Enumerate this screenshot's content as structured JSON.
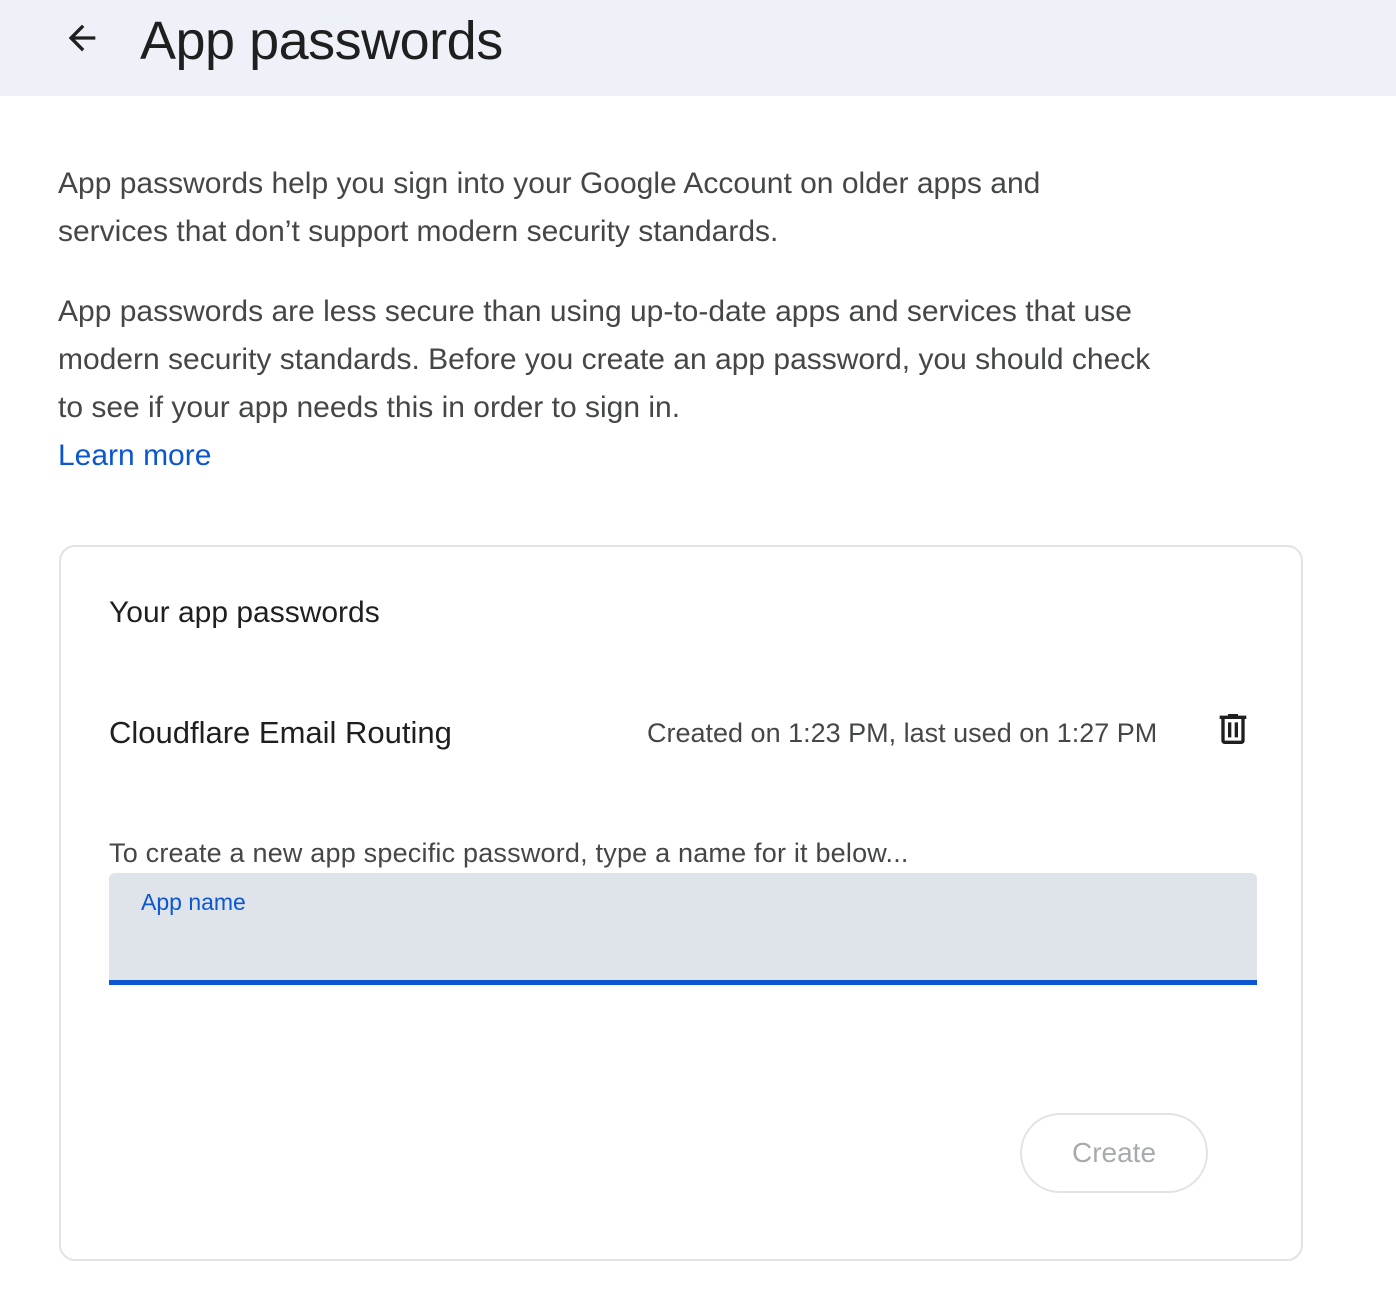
{
  "header": {
    "back_icon": "arrow-left-icon",
    "title": "App passwords"
  },
  "intro": {
    "paragraph1": "App passwords help you sign into your Google Account on older apps and services that don’t support modern security standards.",
    "paragraph2": "App passwords are less secure than using up-to-date apps and services that use modern security standards. Before you create an app password, you should check to see if your app needs this in order to sign in.",
    "learn_more": "Learn more"
  },
  "card": {
    "title": "Your app passwords",
    "passwords": [
      {
        "name": "Cloudflare Email Routing",
        "meta": "Created on 1:23 PM, last used on 1:27 PM",
        "delete_icon": "trash-icon"
      }
    ],
    "hint": "To create a new app specific password, type a name for it below...",
    "field": {
      "label": "App name",
      "value": ""
    },
    "create_label": "Create"
  },
  "colors": {
    "header_bg": "#eef2f8",
    "accent": "#0b57d0",
    "field_bg": "#dfe3ea",
    "disabled_text": "#a8abae"
  }
}
